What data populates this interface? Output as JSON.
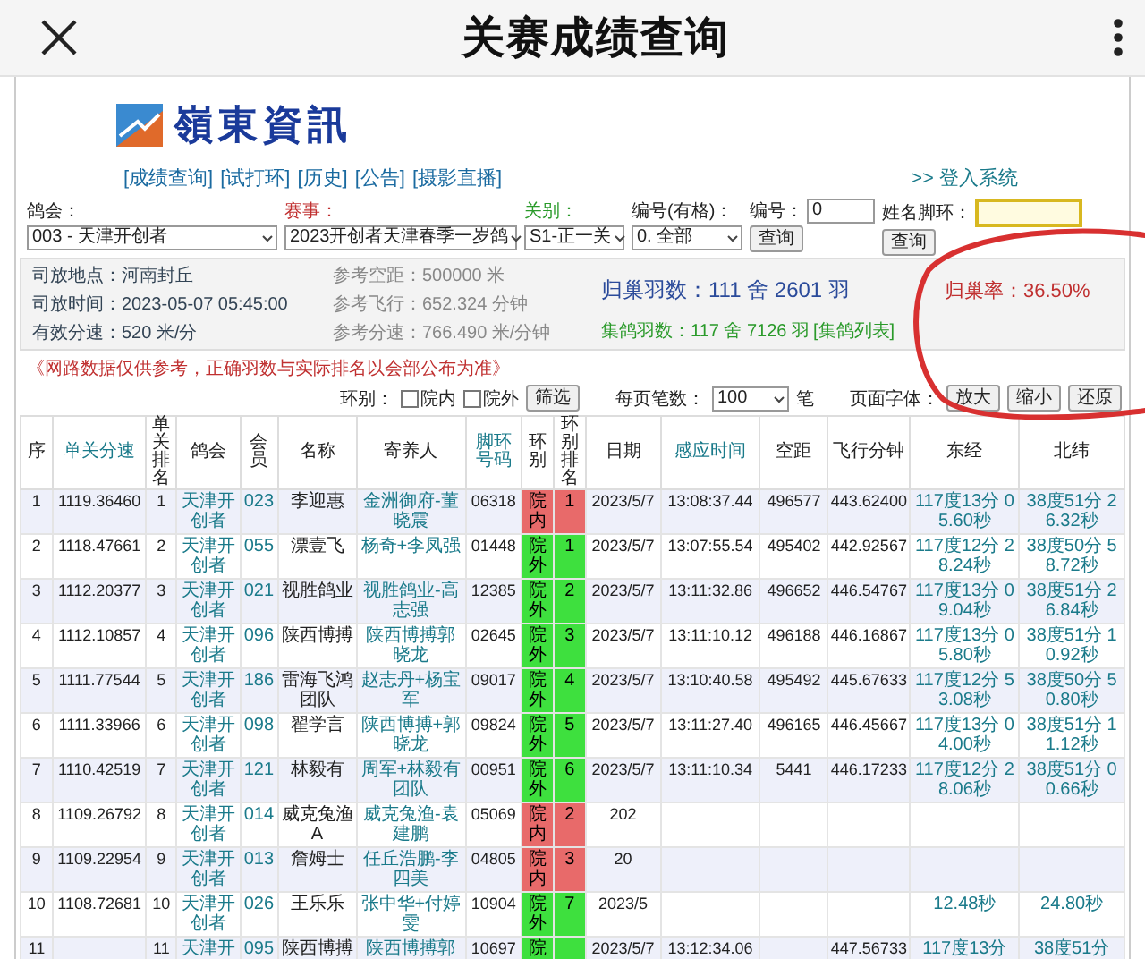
{
  "topbar": {
    "title": "关赛成绩查询"
  },
  "logo": {
    "text": "嶺東資訊"
  },
  "nav": {
    "links": [
      "[成绩查询]",
      "[试打环]",
      "[历史]",
      "[公告]",
      "[摄影直播]"
    ],
    "login": ">> 登入系统"
  },
  "filters": [
    {
      "kind": "select",
      "label": "鸽会：",
      "value": "003 - 天津开创者",
      "color": "#222222"
    },
    {
      "kind": "select",
      "label": "赛事：",
      "value": "2023开创者天津春季一岁鸽",
      "color": "#c03030"
    },
    {
      "kind": "select",
      "label": "关别：",
      "value": "S1-正一关",
      "color": "#2a9a2a"
    },
    {
      "kind": "select",
      "label": "编号(有格)：",
      "value": "0. 全部",
      "color": "#222222"
    },
    {
      "kind": "input",
      "label": "编号：",
      "value": "0",
      "button": "查询",
      "focused": false,
      "color": "#222222"
    },
    {
      "kind": "input",
      "label": "姓名脚环：",
      "button": "查询",
      "focused": true,
      "color": "#222222"
    }
  ],
  "summary": {
    "left": [
      "司放地点：河南封丘",
      "司放时间：2023-05-07 05:45:00",
      "有效分速：520 米/分"
    ],
    "middle": [
      "参考空距：500000 米",
      "参考飞行：652.324 分钟",
      "参考分速：766.490 米/分钟"
    ],
    "returned": "归巢羽数：111 舍 2601 羽",
    "collected": "集鸽羽数：117 舍 7126 羽",
    "collected_link": "[集鸽列表]",
    "rate": "归巢率：36.50%"
  },
  "notice": "《网路数据仅供参考，正确羽数与实际排名以会部公布为准》",
  "toolbar": {
    "ring_label": "环别：",
    "checkboxes": [
      {
        "label": "院内",
        "checked": false
      },
      {
        "label": "院外",
        "checked": false
      }
    ],
    "filter_button": "筛选",
    "per_page_label": "每页笔数：",
    "per_page": "100",
    "per_page_unit": "笔",
    "font_label": "页面字体：",
    "font_buttons": [
      "放大",
      "缩小",
      "还原"
    ]
  },
  "table": {
    "columns": [
      {
        "label": "序",
        "link": false
      },
      {
        "label": "单关分速",
        "link": true
      },
      {
        "label": "单关排名",
        "link": false
      },
      {
        "label": "鸽会",
        "link": false
      },
      {
        "label": "会员",
        "link": false
      },
      {
        "label": "名称",
        "link": false
      },
      {
        "label": "寄养人",
        "link": false
      },
      {
        "label": "脚环号码",
        "link": true
      },
      {
        "label": "环别",
        "link": false
      },
      {
        "label": "环别排名",
        "link": false
      },
      {
        "label": "日期",
        "link": false
      },
      {
        "label": "感应时间",
        "link": true
      },
      {
        "label": "空距",
        "link": false
      },
      {
        "label": "飞行分钟",
        "link": false
      },
      {
        "label": "东经",
        "link": false
      },
      {
        "label": "北纬",
        "link": false
      }
    ],
    "rows": [
      {
        "no": "1",
        "speed": "1119.36460",
        "rank": "1",
        "club": "天津开创者",
        "member": "023",
        "name": "李迎惠",
        "owner": "金洲御府-董晓震",
        "ring": "06318",
        "ring_status": {
          "label": "院内",
          "inside": true
        },
        "ring_rank": "1",
        "date": "2023/5/7",
        "time": "13:08:37.44",
        "distance": "496577",
        "minutes": "443.62400",
        "east": "117度13分 05.60秒",
        "north": "38度51分 26.32秒"
      },
      {
        "no": "2",
        "speed": "1118.47661",
        "rank": "2",
        "club": "天津开创者",
        "member": "055",
        "name": "漂壹飞",
        "owner": "杨奇+李凤强",
        "ring": "01448",
        "ring_status": {
          "label": "院外",
          "inside": false
        },
        "ring_rank": "1",
        "date": "2023/5/7",
        "time": "13:07:55.54",
        "distance": "495402",
        "minutes": "442.92567",
        "east": "117度12分 28.24秒",
        "north": "38度50分 58.72秒"
      },
      {
        "no": "3",
        "speed": "1112.20377",
        "rank": "3",
        "club": "天津开创者",
        "member": "021",
        "name": "视胜鸽业",
        "owner": "视胜鸽业-高志强",
        "ring": "12385",
        "ring_status": {
          "label": "院外",
          "inside": false
        },
        "ring_rank": "2",
        "date": "2023/5/7",
        "time": "13:11:32.86",
        "distance": "496652",
        "minutes": "446.54767",
        "east": "117度13分 09.04秒",
        "north": "38度51分 26.84秒"
      },
      {
        "no": "4",
        "speed": "1112.10857",
        "rank": "4",
        "club": "天津开创者",
        "member": "096",
        "name": "陕西博搏",
        "owner": "陕西博搏郭晓龙",
        "ring": "02645",
        "ring_status": {
          "label": "院外",
          "inside": false
        },
        "ring_rank": "3",
        "date": "2023/5/7",
        "time": "13:11:10.12",
        "distance": "496188",
        "minutes": "446.16867",
        "east": "117度13分 05.80秒",
        "north": "38度51分 10.92秒"
      },
      {
        "no": "5",
        "speed": "1111.77544",
        "rank": "5",
        "club": "天津开创者",
        "member": "186",
        "name": "雷海飞鸿团队",
        "owner": "赵志丹+杨宝军",
        "ring": "09017",
        "ring_status": {
          "label": "院外",
          "inside": false
        },
        "ring_rank": "4",
        "date": "2023/5/7",
        "time": "13:10:40.58",
        "distance": "495492",
        "minutes": "445.67633",
        "east": "117度12分 53.08秒",
        "north": "38度50分 50.80秒"
      },
      {
        "no": "6",
        "speed": "1111.33966",
        "rank": "6",
        "club": "天津开创者",
        "member": "098",
        "name": "翟学言",
        "owner": "陕西博搏+郭晓龙",
        "ring": "09824",
        "ring_status": {
          "label": "院外",
          "inside": false
        },
        "ring_rank": "5",
        "date": "2023/5/7",
        "time": "13:11:27.40",
        "distance": "496165",
        "minutes": "446.45667",
        "east": "117度13分 04.00秒",
        "north": "38度51分 11.12秒"
      },
      {
        "no": "7",
        "speed": "1110.42519",
        "rank": "7",
        "club": "天津开创者",
        "member": "121",
        "name": "林毅有",
        "owner": "周军+林毅有团队",
        "ring": "00951",
        "ring_status": {
          "label": "院外",
          "inside": false
        },
        "ring_rank": "6",
        "date": "2023/5/7",
        "time": "13:11:10.34",
        "distance": "5441",
        "minutes": "446.17233",
        "east": "117度12分 28.06秒",
        "north": "38度51分 00.66秒"
      },
      {
        "no": "8",
        "speed": "1109.26792",
        "rank": "8",
        "club": "天津开创者",
        "member": "014",
        "name": "威克兔渔A",
        "owner": "威克兔渔-袁建鹏",
        "ring": "05069",
        "ring_status": {
          "label": "院内",
          "inside": true
        },
        "ring_rank": "2",
        "date": "202"
      },
      {
        "no": "9",
        "speed": "1109.22954",
        "rank": "9",
        "club": "天津开创者",
        "member": "013",
        "name": "詹姆士",
        "owner": "任丘浩鹏-李四美",
        "ring": "04805",
        "ring_status": {
          "label": "院内",
          "inside": true
        },
        "ring_rank": "3",
        "date": "20"
      },
      {
        "no": "10",
        "speed": "1108.72681",
        "rank": "10",
        "club": "天津开创者",
        "member": "026",
        "name": "王乐乐",
        "owner": "张中华+付婷雯",
        "ring": "10904",
        "ring_status": {
          "label": "院外",
          "inside": false
        },
        "ring_rank": "7",
        "date": "2023/5",
        "east": "12.48秒",
        "north": "24.80秒"
      },
      {
        "no": "11",
        "rank": "11",
        "club": "天津开",
        "member": "095",
        "name": "陕西博搏",
        "owner": "陕西博搏郭",
        "ring": "10697",
        "ring_status": {
          "label": "院",
          "inside": false
        },
        "date": "2023/5/7",
        "time": "13:12:34.06",
        "minutes": "447.56733",
        "east": "117度13分",
        "north": "38度51分"
      }
    ]
  }
}
